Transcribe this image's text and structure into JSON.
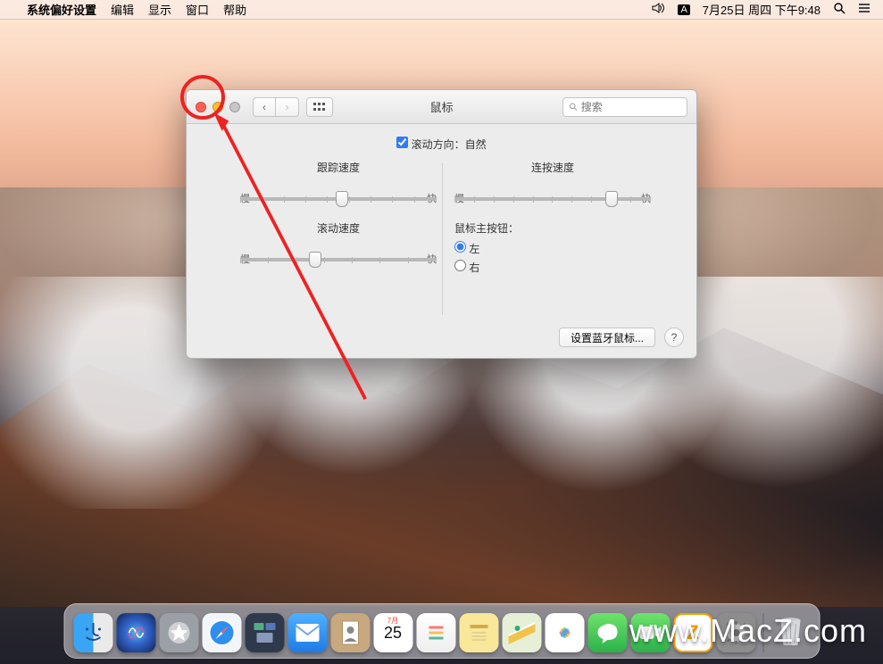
{
  "menubar": {
    "app": "系统偏好设置",
    "items": [
      "编辑",
      "显示",
      "窗口",
      "帮助"
    ],
    "datetime": "7月25日 周四 下午9:48"
  },
  "window": {
    "title": "鼠标",
    "search_placeholder": "搜索",
    "scroll_direction_label": "滚动方向：自然",
    "tracking_speed_label": "跟踪速度",
    "scroll_speed_label": "滚动速度",
    "double_click_speed_label": "连按速度",
    "slow_label": "慢",
    "fast_label": "快",
    "primary_button_label": "鼠标主按钮：",
    "primary_left": "左",
    "primary_right": "右",
    "bluetooth_button": "设置蓝牙鼠标...",
    "help_label": "?"
  },
  "calendar": {
    "month": "7月",
    "day": "25"
  },
  "watermark": "www.MacZ.com",
  "dock": {
    "items": [
      "finder",
      "siri",
      "launchpad",
      "safari",
      "mission",
      "mail",
      "contacts",
      "calendar",
      "reminders",
      "notes",
      "maps",
      "photos",
      "messages",
      "facetime",
      "zlogo",
      "prefs"
    ]
  }
}
